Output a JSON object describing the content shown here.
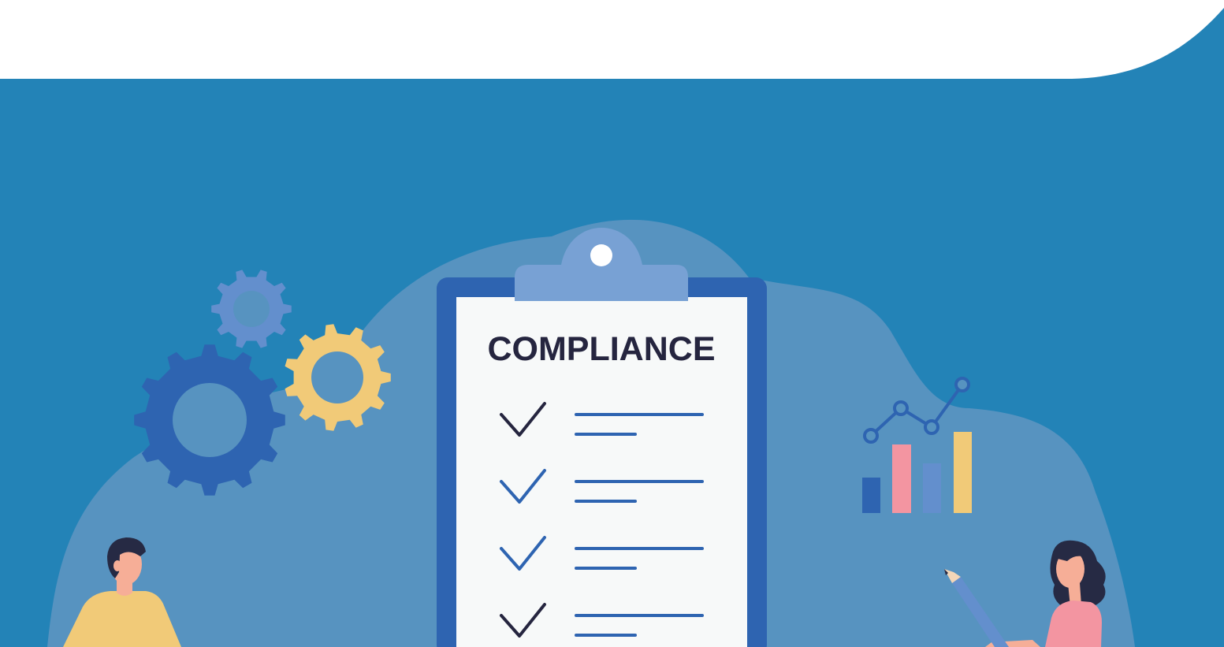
{
  "clipboard": {
    "title": "COMPLIANCE",
    "items": [
      {
        "checked": true,
        "check_color": "#25253f"
      },
      {
        "checked": true,
        "check_color": "#2e64b1"
      },
      {
        "checked": true,
        "check_color": "#2e64b1"
      },
      {
        "checked": true,
        "check_color": "#25253f"
      }
    ]
  },
  "icons": [
    "gear-icon",
    "bar-chart-icon",
    "line-chart-icon",
    "pencil-icon",
    "checkmark-icon"
  ],
  "colors": {
    "background": "#2383b7",
    "blob": "#5793c0",
    "header": "#ffffff",
    "clipboard_board": "#2e64b1",
    "clipboard_clip": "#78a1d4",
    "paper": "#f7f9f9",
    "gear_dark": "#2e64b1",
    "gear_light": "#638fcd",
    "gear_yellow": "#f1ca78",
    "bar_pink": "#f395a1",
    "skin": "#f6ae97",
    "hair": "#262a44",
    "shirt_yellow": "#f1ca78",
    "shirt_pink": "#f395a1"
  }
}
